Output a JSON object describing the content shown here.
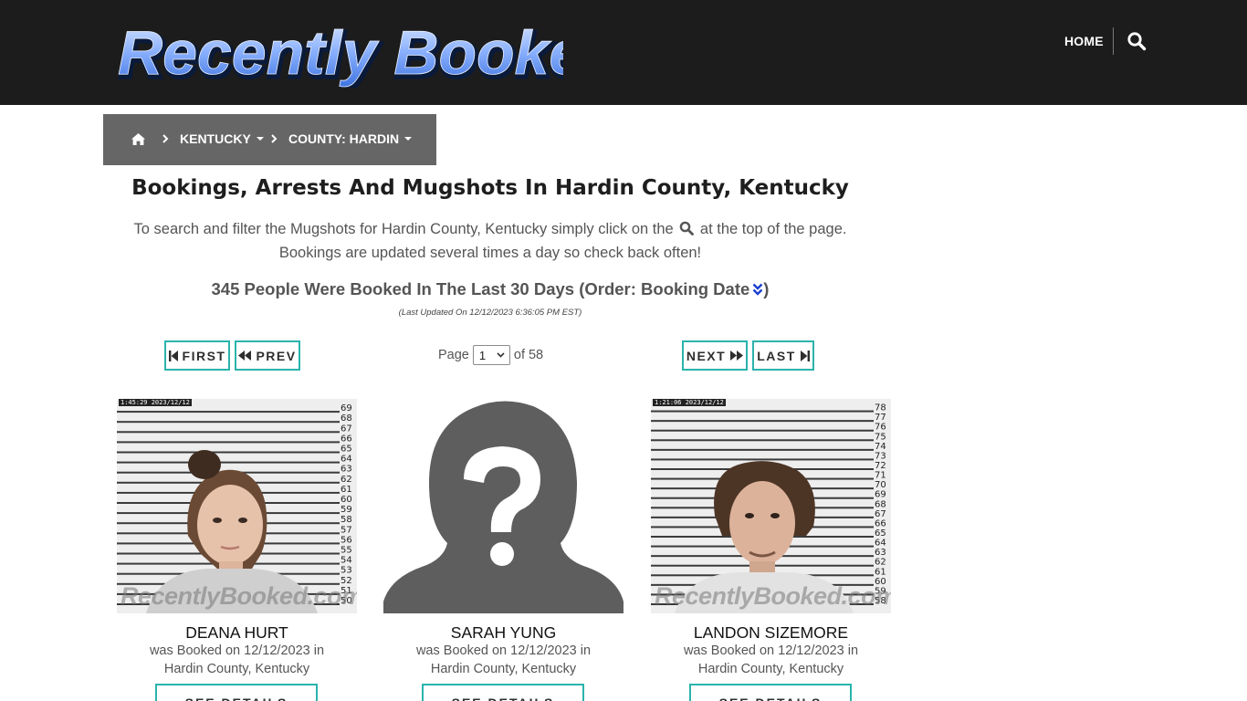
{
  "header": {
    "logo_text": "Recently Booked",
    "nav_home": "HOME"
  },
  "breadcrumb": {
    "state": "KENTUCKY",
    "county": "COUNTY: HARDIN"
  },
  "page": {
    "title": "Bookings, Arrests And Mugshots In Hardin County, Kentucky",
    "intro_before": "To search and filter the Mugshots for Hardin County, Kentucky simply click on the",
    "intro_after": "at the top of the page.",
    "intro_line2": "Bookings are updated several times a day so check back often!",
    "count_text": "345 People Were Booked In The Last 30 Days (Order: Booking Date",
    "count_close": ")",
    "last_updated": "(Last Updated On 12/12/2023 6:36:05 PM EST)"
  },
  "pagination": {
    "first": "FIRST",
    "prev": "PREV",
    "next": "NEXT",
    "last": "LAST",
    "page_label": "Page",
    "current_page": "1",
    "of_label": "of 58"
  },
  "bookings": [
    {
      "name": "DEANA HURT",
      "booked_line": "was Booked on 12/12/2023 in",
      "location": "Hardin County, Kentucky",
      "photo_stamp": "1:45:29  2023/12/12",
      "ruler_numbers": [
        "69",
        "68",
        "67",
        "66",
        "65",
        "64",
        "63",
        "62",
        "61",
        "60",
        "59",
        "58",
        "57",
        "56",
        "55",
        "54",
        "53",
        "52",
        "51",
        "50"
      ],
      "watermark": "RecentlyBooked.com",
      "details_label": "SEE DETAILS"
    },
    {
      "name": "SARAH YUNG",
      "booked_line": "was Booked on 12/12/2023 in",
      "location": "Hardin County, Kentucky",
      "details_label": "SEE DETAILS"
    },
    {
      "name": "LANDON SIZEMORE",
      "booked_line": "was Booked on 12/12/2023 in",
      "location": "Hardin County, Kentucky",
      "photo_stamp": "1:21:06  2023/12/12",
      "ruler_numbers": [
        "78",
        "77",
        "76",
        "75",
        "74",
        "73",
        "72",
        "71",
        "70",
        "69",
        "68",
        "67",
        "66",
        "65",
        "64",
        "63",
        "62",
        "61",
        "60",
        "59",
        "58"
      ],
      "watermark": "RecentlyBooked.com",
      "details_label": "SEE DETAILS"
    }
  ],
  "colors": {
    "header_bg": "#1c1c1c",
    "breadcrumb_bg": "#666666",
    "accent_teal": "#2ab3ad",
    "logo_blue": "#8fb4ff",
    "order_icon_blue": "#1d3fd0"
  },
  "icons": {
    "nav_search": "search-icon",
    "breadcrumb_home": "home-icon",
    "breadcrumb_separator": "chevron-right-icon",
    "order": "double-chevron-down-icon",
    "first": "step-backward-icon",
    "prev": "backward-icon",
    "next": "forward-icon",
    "last": "step-forward-icon"
  }
}
